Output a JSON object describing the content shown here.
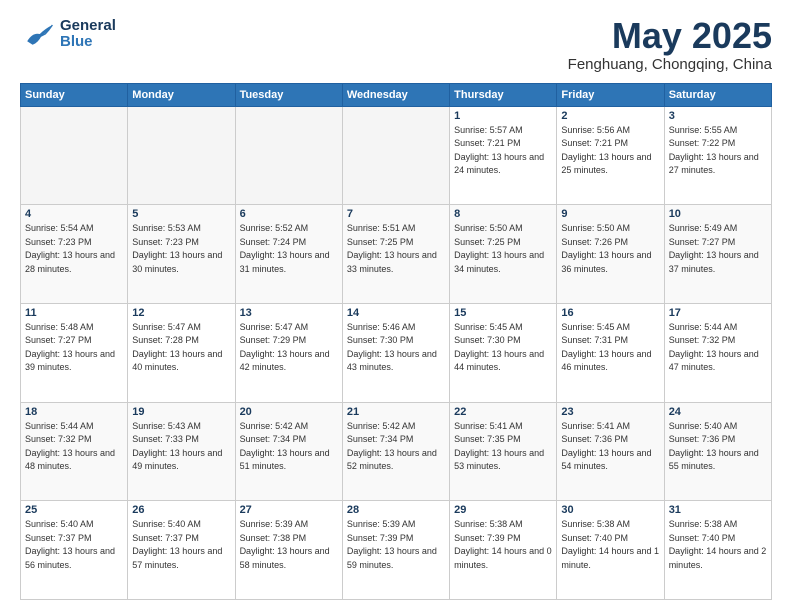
{
  "header": {
    "logo_general": "General",
    "logo_blue": "Blue",
    "month_title": "May 2025",
    "location": "Fenghuang, Chongqing, China"
  },
  "days_of_week": [
    "Sunday",
    "Monday",
    "Tuesday",
    "Wednesday",
    "Thursday",
    "Friday",
    "Saturday"
  ],
  "weeks": [
    [
      {
        "day": "",
        "empty": true
      },
      {
        "day": "",
        "empty": true
      },
      {
        "day": "",
        "empty": true
      },
      {
        "day": "",
        "empty": true
      },
      {
        "day": "1",
        "sunrise": "5:57 AM",
        "sunset": "7:21 PM",
        "daylight": "13 hours and 24 minutes."
      },
      {
        "day": "2",
        "sunrise": "5:56 AM",
        "sunset": "7:21 PM",
        "daylight": "13 hours and 25 minutes."
      },
      {
        "day": "3",
        "sunrise": "5:55 AM",
        "sunset": "7:22 PM",
        "daylight": "13 hours and 27 minutes."
      }
    ],
    [
      {
        "day": "4",
        "sunrise": "5:54 AM",
        "sunset": "7:23 PM",
        "daylight": "13 hours and 28 minutes."
      },
      {
        "day": "5",
        "sunrise": "5:53 AM",
        "sunset": "7:23 PM",
        "daylight": "13 hours and 30 minutes."
      },
      {
        "day": "6",
        "sunrise": "5:52 AM",
        "sunset": "7:24 PM",
        "daylight": "13 hours and 31 minutes."
      },
      {
        "day": "7",
        "sunrise": "5:51 AM",
        "sunset": "7:25 PM",
        "daylight": "13 hours and 33 minutes."
      },
      {
        "day": "8",
        "sunrise": "5:50 AM",
        "sunset": "7:25 PM",
        "daylight": "13 hours and 34 minutes."
      },
      {
        "day": "9",
        "sunrise": "5:50 AM",
        "sunset": "7:26 PM",
        "daylight": "13 hours and 36 minutes."
      },
      {
        "day": "10",
        "sunrise": "5:49 AM",
        "sunset": "7:27 PM",
        "daylight": "13 hours and 37 minutes."
      }
    ],
    [
      {
        "day": "11",
        "sunrise": "5:48 AM",
        "sunset": "7:27 PM",
        "daylight": "13 hours and 39 minutes."
      },
      {
        "day": "12",
        "sunrise": "5:47 AM",
        "sunset": "7:28 PM",
        "daylight": "13 hours and 40 minutes."
      },
      {
        "day": "13",
        "sunrise": "5:47 AM",
        "sunset": "7:29 PM",
        "daylight": "13 hours and 42 minutes."
      },
      {
        "day": "14",
        "sunrise": "5:46 AM",
        "sunset": "7:30 PM",
        "daylight": "13 hours and 43 minutes."
      },
      {
        "day": "15",
        "sunrise": "5:45 AM",
        "sunset": "7:30 PM",
        "daylight": "13 hours and 44 minutes."
      },
      {
        "day": "16",
        "sunrise": "5:45 AM",
        "sunset": "7:31 PM",
        "daylight": "13 hours and 46 minutes."
      },
      {
        "day": "17",
        "sunrise": "5:44 AM",
        "sunset": "7:32 PM",
        "daylight": "13 hours and 47 minutes."
      }
    ],
    [
      {
        "day": "18",
        "sunrise": "5:44 AM",
        "sunset": "7:32 PM",
        "daylight": "13 hours and 48 minutes."
      },
      {
        "day": "19",
        "sunrise": "5:43 AM",
        "sunset": "7:33 PM",
        "daylight": "13 hours and 49 minutes."
      },
      {
        "day": "20",
        "sunrise": "5:42 AM",
        "sunset": "7:34 PM",
        "daylight": "13 hours and 51 minutes."
      },
      {
        "day": "21",
        "sunrise": "5:42 AM",
        "sunset": "7:34 PM",
        "daylight": "13 hours and 52 minutes."
      },
      {
        "day": "22",
        "sunrise": "5:41 AM",
        "sunset": "7:35 PM",
        "daylight": "13 hours and 53 minutes."
      },
      {
        "day": "23",
        "sunrise": "5:41 AM",
        "sunset": "7:36 PM",
        "daylight": "13 hours and 54 minutes."
      },
      {
        "day": "24",
        "sunrise": "5:40 AM",
        "sunset": "7:36 PM",
        "daylight": "13 hours and 55 minutes."
      }
    ],
    [
      {
        "day": "25",
        "sunrise": "5:40 AM",
        "sunset": "7:37 PM",
        "daylight": "13 hours and 56 minutes."
      },
      {
        "day": "26",
        "sunrise": "5:40 AM",
        "sunset": "7:37 PM",
        "daylight": "13 hours and 57 minutes."
      },
      {
        "day": "27",
        "sunrise": "5:39 AM",
        "sunset": "7:38 PM",
        "daylight": "13 hours and 58 minutes."
      },
      {
        "day": "28",
        "sunrise": "5:39 AM",
        "sunset": "7:39 PM",
        "daylight": "13 hours and 59 minutes."
      },
      {
        "day": "29",
        "sunrise": "5:38 AM",
        "sunset": "7:39 PM",
        "daylight": "14 hours and 0 minutes."
      },
      {
        "day": "30",
        "sunrise": "5:38 AM",
        "sunset": "7:40 PM",
        "daylight": "14 hours and 1 minute."
      },
      {
        "day": "31",
        "sunrise": "5:38 AM",
        "sunset": "7:40 PM",
        "daylight": "14 hours and 2 minutes."
      }
    ]
  ],
  "labels": {
    "sunrise_label": "Sunrise:",
    "sunset_label": "Sunset:",
    "daylight_label": "Daylight:"
  }
}
